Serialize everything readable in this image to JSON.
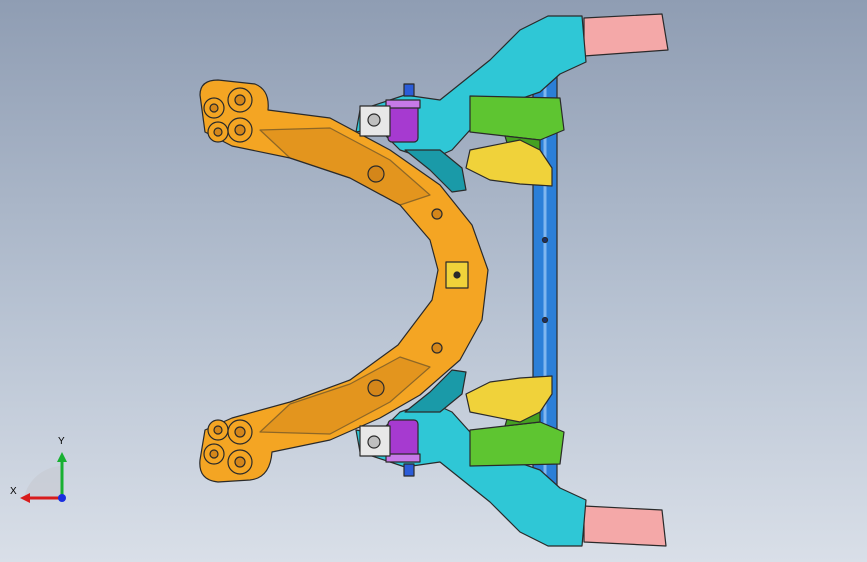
{
  "viewport": {
    "background_top": "#8f9db3",
    "background_bottom": "#d9dfe8"
  },
  "model": {
    "colors": {
      "orange_arm": "#f4a523",
      "orange_dark": "#d4861a",
      "cyan_frame": "#2fc7d6",
      "cyan_dark": "#1a9aa8",
      "blue_tube": "#2b7fd8",
      "green_bracket": "#5ec531",
      "yellow_bracket": "#f0d23a",
      "purple_bushing": "#a63ad0",
      "pink_extension": "#f4a8a8",
      "outline": "#2a2a2a"
    }
  },
  "triad": {
    "x_label": "X",
    "y_label": "Y",
    "x_color": "#d81b1b",
    "y_color": "#18b032",
    "z_color": "#1a2ee0"
  }
}
